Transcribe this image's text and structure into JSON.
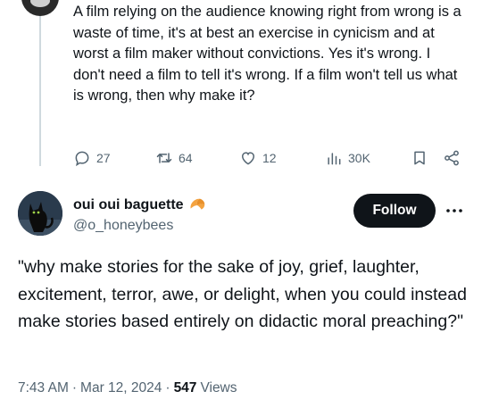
{
  "reply": {
    "text": "A film relying on the audience knowing right from wrong is a waste of time, it's at best an exercise in cynicism and at worst a film maker without convictions. Yes it's wrong. I don't need a film to tell it's wrong. If a film won't tell us what is wrong, then why make it?",
    "actions": {
      "replies": "27",
      "reposts": "64",
      "likes": "12",
      "views": "30K"
    }
  },
  "tweet": {
    "author_name": "oui oui baguette",
    "author_emoji_icon": "croissant-icon",
    "author_handle": "@o_honeybees",
    "follow_label": "Follow",
    "text": "\"why make stories for the sake of joy, grief, laughter, excitement, terror, awe, or delight, when you could instead make stories based entirely on didactic moral preaching?\"",
    "time": "7:43 AM",
    "date": "Mar 12, 2024",
    "views_count": "547",
    "views_label": "Views",
    "separator": "·"
  },
  "colors": {
    "text": "#0f1419",
    "secondary": "#536471",
    "follow_bg": "#0f1419",
    "thread_line": "#cfd9de"
  }
}
